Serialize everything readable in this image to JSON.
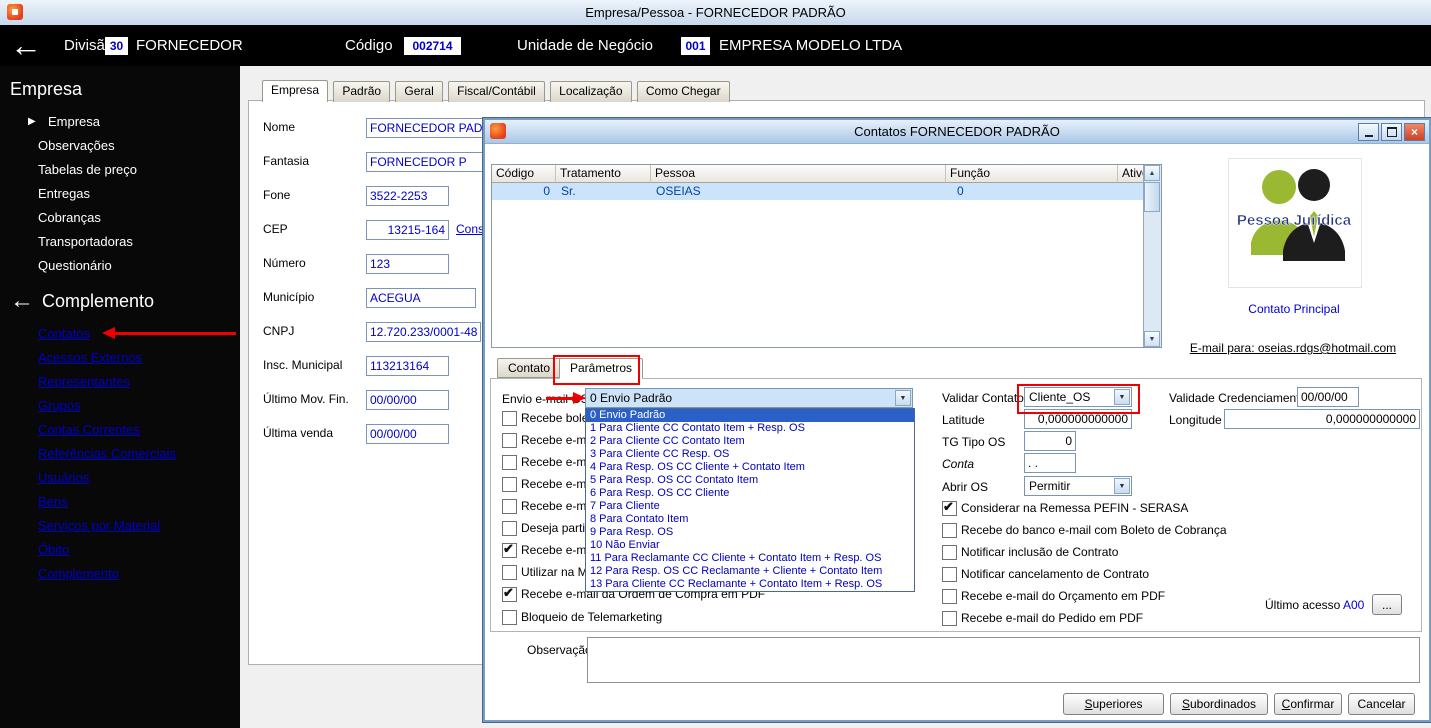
{
  "titlebar": {
    "title": "Empresa/Pessoa - FORNECEDOR PADRÃO"
  },
  "header": {
    "division_label": "Divisão",
    "division_code": "30",
    "division_name": "FORNECEDOR",
    "code_label": "Código",
    "code_value": "002714",
    "business_unit_label": "Unidade de Negócio",
    "business_unit_code": "001",
    "business_unit_name": "EMPRESA MODELO LTDA"
  },
  "sidebar": {
    "empresa": {
      "title": "Empresa",
      "items": [
        "Empresa",
        "Observações",
        "Tabelas de preço",
        "Entregas",
        "Cobranças",
        "Transportadoras",
        "Questionário"
      ]
    },
    "complemento": {
      "title": "Complemento",
      "items": [
        "Contatos",
        "Acessos Externos",
        "Representantes",
        "Grupos",
        "Contas Correntes",
        "Referências Comerciais",
        "Usuários",
        "Bens",
        "Serviços por Material",
        "Óbito",
        "Complemento"
      ]
    }
  },
  "main": {
    "tabs": [
      "Empresa",
      "Padrão",
      "Geral",
      "Fiscal/Contábil",
      "Localização",
      "Como Chegar"
    ],
    "fields": {
      "nome": {
        "label": "Nome",
        "value": "FORNECEDOR PADRÃO"
      },
      "fantasia": {
        "label": "Fantasia",
        "value": "FORNECEDOR P"
      },
      "fone": {
        "label": "Fone",
        "value": "3522-2253"
      },
      "cep": {
        "label": "CEP",
        "value": "13215-164",
        "link": "Cons"
      },
      "numero": {
        "label": "Número",
        "value": "123"
      },
      "municipio": {
        "label": "Município",
        "value": "ACEGUA"
      },
      "cnpj": {
        "label": "CNPJ",
        "value": "12.720.233/0001-48"
      },
      "insc_municipal": {
        "label": "Insc. Municipal",
        "value": "113213164"
      },
      "ultimo_mov": {
        "label": "Último Mov. Fin.",
        "value": "00/00/00"
      },
      "ultima_venda": {
        "label": "Última venda",
        "value": "00/00/00"
      }
    }
  },
  "modal": {
    "title": "Contatos FORNECEDOR PADRÃO",
    "table": {
      "columns": [
        "Código",
        "Tratamento",
        "Pessoa",
        "Função",
        "Ativo"
      ],
      "row": {
        "codigo": "0",
        "tratamento": "Sr.",
        "pessoa": "OSEIAS",
        "funcao": "0",
        "ativo": ""
      }
    },
    "side": {
      "image_caption": "Pessoa Jurídica",
      "principal_link": "Contato Principal",
      "email_link": "E-mail para: oseias.rdgs@hotmail.com"
    },
    "tabs": {
      "contato": "Contato",
      "parametros": "Parâmetros"
    },
    "params": {
      "envio": {
        "label": "Envio e-mail GS",
        "value": "0 Envio Padrão",
        "options": [
          "0 Envio Padrão",
          "1 Para Cliente CC Contato Item + Resp. OS",
          "2 Para Cliente CC Contato Item",
          "3 Para Cliente CC Resp. OS",
          "4 Para Resp. OS CC Cliente + Contato Item",
          "5 Para Resp. OS CC Contato Item",
          "6 Para Resp. OS CC Cliente",
          "7 Para Cliente",
          "8 Para Contato Item",
          "9 Para Resp. OS",
          "10 Não Enviar",
          "11 Para Reclamante CC Cliente + Contato Item + Resp. OS",
          "12 Para Resp. OS CC Reclamante + Cliente + Contato Item",
          "13 Para Cliente CC Reclamante + Contato Item + Resp. OS"
        ]
      },
      "left_checks": [
        {
          "label": "Recebe boleto p",
          "checked": false
        },
        {
          "label": "Recebe e-ma",
          "checked": false
        },
        {
          "label": "Recebe e-ma",
          "checked": false
        },
        {
          "label": "Recebe e-ma",
          "checked": false
        },
        {
          "label": "Recebe e-ma",
          "checked": false
        },
        {
          "label": "Deseja partic",
          "checked": false
        },
        {
          "label": "Recebe e-ma",
          "checked": true
        },
        {
          "label": "Utilizar na Mo",
          "checked": false
        },
        {
          "label": "Recebe e-mail da Ordem de Compra em PDF",
          "checked": true
        },
        {
          "label": "Bloqueio de Telemarketing",
          "checked": false
        }
      ],
      "validar": {
        "label": "Validar Contato",
        "value": "Cliente_OS"
      },
      "latitude": {
        "label": "Latitude",
        "value": "0,000000000000"
      },
      "tg_tipo": {
        "label": "TG Tipo OS",
        "value": "0"
      },
      "conta": {
        "label": "Conta",
        "value": ". ."
      },
      "abrir_os": {
        "label": "Abrir OS",
        "value": "Permitir"
      },
      "right_checks": [
        {
          "label": "Considerar na Remessa PEFIN - SERASA",
          "checked": true
        },
        {
          "label": "Recebe do banco e-mail com Boleto de Cobrança",
          "checked": false
        },
        {
          "label": "Notificar inclusão de Contrato",
          "checked": false
        },
        {
          "label": "Notificar cancelamento de Contrato",
          "checked": false
        },
        {
          "label": "Recebe e-mail do Orçamento em PDF",
          "checked": false
        },
        {
          "label": "Recebe e-mail do Pedido em PDF",
          "checked": false
        }
      ],
      "validade": {
        "label": "Validade Credenciamento",
        "value": "00/00/00"
      },
      "longitude": {
        "label": "Longitude",
        "value": "0,000000000000"
      },
      "ultimo_acesso": {
        "label": "Último acesso",
        "value": "A00",
        "button": "..."
      }
    },
    "footer": {
      "observacao_label": "Observação",
      "buttons": [
        "Superiores",
        "Subordinados",
        "Confirmar",
        "Cancelar"
      ]
    }
  },
  "colors": {
    "annotation_red": "#ee0000",
    "selection_blue": "#2a60c8",
    "value_blue": "#0000cc"
  }
}
